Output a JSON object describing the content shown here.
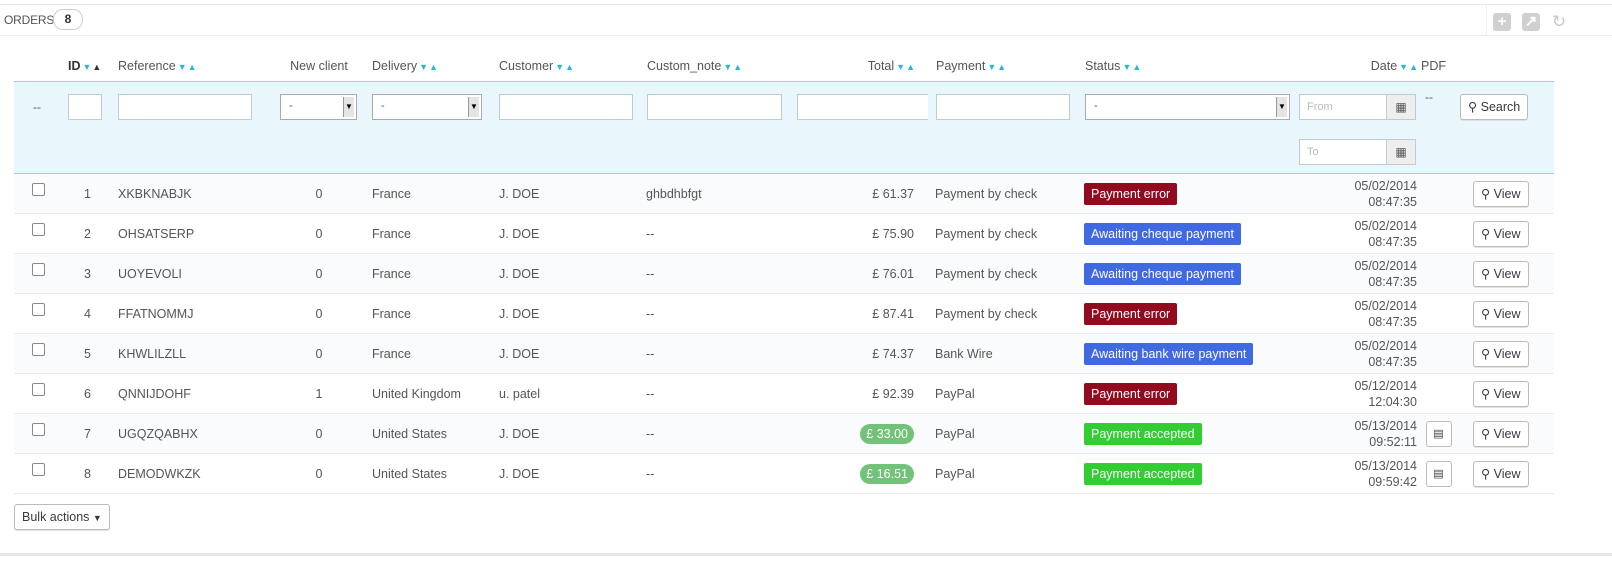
{
  "header": {
    "title": "ORDERS",
    "count": "8"
  },
  "toolbar": {
    "icons": [
      "add-icon",
      "export-icon",
      "refresh-icon"
    ]
  },
  "columns": {
    "id": "ID",
    "reference": "Reference",
    "new_client": "New client",
    "delivery": "Delivery",
    "customer": "Customer",
    "custom_note": "Custom_note",
    "total": "Total",
    "payment": "Payment",
    "status": "Status",
    "date": "Date",
    "pdf": "PDF"
  },
  "filters": {
    "bulk_placeholder": "--",
    "new_client_value": "-",
    "delivery_value": "-",
    "status_value": "-",
    "date_from_placeholder": "From",
    "date_to_placeholder": "To",
    "pdf_placeholder": "--",
    "search_label": "Search"
  },
  "colors": {
    "payment_error": "#920a1e",
    "awaiting": "#4169e1",
    "accepted": "#32cd32",
    "total_highlight": "#72c279",
    "accent": "#25b9d7"
  },
  "rows": [
    {
      "id": "1",
      "reference": "XKBKNABJK",
      "new_client": "0",
      "delivery": "France",
      "customer": "J. DOE",
      "custom_note": "ghbdhbfgt",
      "total": "£ 61.37",
      "total_highlight": false,
      "payment": "Payment by check",
      "status": "Payment error",
      "status_color": "#920a1e",
      "date": "05/02/2014",
      "time": "08:47:35",
      "has_pdf": false,
      "view_label": "View"
    },
    {
      "id": "2",
      "reference": "OHSATSERP",
      "new_client": "0",
      "delivery": "France",
      "customer": "J. DOE",
      "custom_note": "--",
      "total": "£ 75.90",
      "total_highlight": false,
      "payment": "Payment by check",
      "status": "Awaiting cheque payment",
      "status_color": "#4169e1",
      "date": "05/02/2014",
      "time": "08:47:35",
      "has_pdf": false,
      "view_label": "View"
    },
    {
      "id": "3",
      "reference": "UOYEVOLI",
      "new_client": "0",
      "delivery": "France",
      "customer": "J. DOE",
      "custom_note": "--",
      "total": "£ 76.01",
      "total_highlight": false,
      "payment": "Payment by check",
      "status": "Awaiting cheque payment",
      "status_color": "#4169e1",
      "date": "05/02/2014",
      "time": "08:47:35",
      "has_pdf": false,
      "view_label": "View"
    },
    {
      "id": "4",
      "reference": "FFATNOMMJ",
      "new_client": "0",
      "delivery": "France",
      "customer": "J. DOE",
      "custom_note": "--",
      "total": "£ 87.41",
      "total_highlight": false,
      "payment": "Payment by check",
      "status": "Payment error",
      "status_color": "#920a1e",
      "date": "05/02/2014",
      "time": "08:47:35",
      "has_pdf": false,
      "view_label": "View"
    },
    {
      "id": "5",
      "reference": "KHWLILZLL",
      "new_client": "0",
      "delivery": "France",
      "customer": "J. DOE",
      "custom_note": "--",
      "total": "£ 74.37",
      "total_highlight": false,
      "payment": "Bank Wire",
      "status": "Awaiting bank wire payment",
      "status_color": "#4169e1",
      "date": "05/02/2014",
      "time": "08:47:35",
      "has_pdf": false,
      "view_label": "View"
    },
    {
      "id": "6",
      "reference": "QNNIJDOHF",
      "new_client": "1",
      "delivery": "United Kingdom",
      "customer": "u. patel",
      "custom_note": "--",
      "total": "£ 92.39",
      "total_highlight": false,
      "payment": "PayPal",
      "status": "Payment error",
      "status_color": "#920a1e",
      "date": "05/12/2014",
      "time": "12:04:30",
      "has_pdf": false,
      "view_label": "View"
    },
    {
      "id": "7",
      "reference": "UGQZQABHX",
      "new_client": "0",
      "delivery": "United States",
      "customer": "J. DOE",
      "custom_note": "--",
      "total": "£ 33.00",
      "total_highlight": true,
      "payment": "PayPal",
      "status": "Payment accepted",
      "status_color": "#32cd32",
      "date": "05/13/2014",
      "time": "09:52:11",
      "has_pdf": true,
      "view_label": "View"
    },
    {
      "id": "8",
      "reference": "DEMODWKZK",
      "new_client": "0",
      "delivery": "United States",
      "customer": "J. DOE",
      "custom_note": "--",
      "total": "£ 16.51",
      "total_highlight": true,
      "payment": "PayPal",
      "status": "Payment accepted",
      "status_color": "#32cd32",
      "date": "05/13/2014",
      "time": "09:59:42",
      "has_pdf": true,
      "view_label": "View"
    }
  ],
  "footer": {
    "bulk_actions_label": "Bulk actions"
  }
}
